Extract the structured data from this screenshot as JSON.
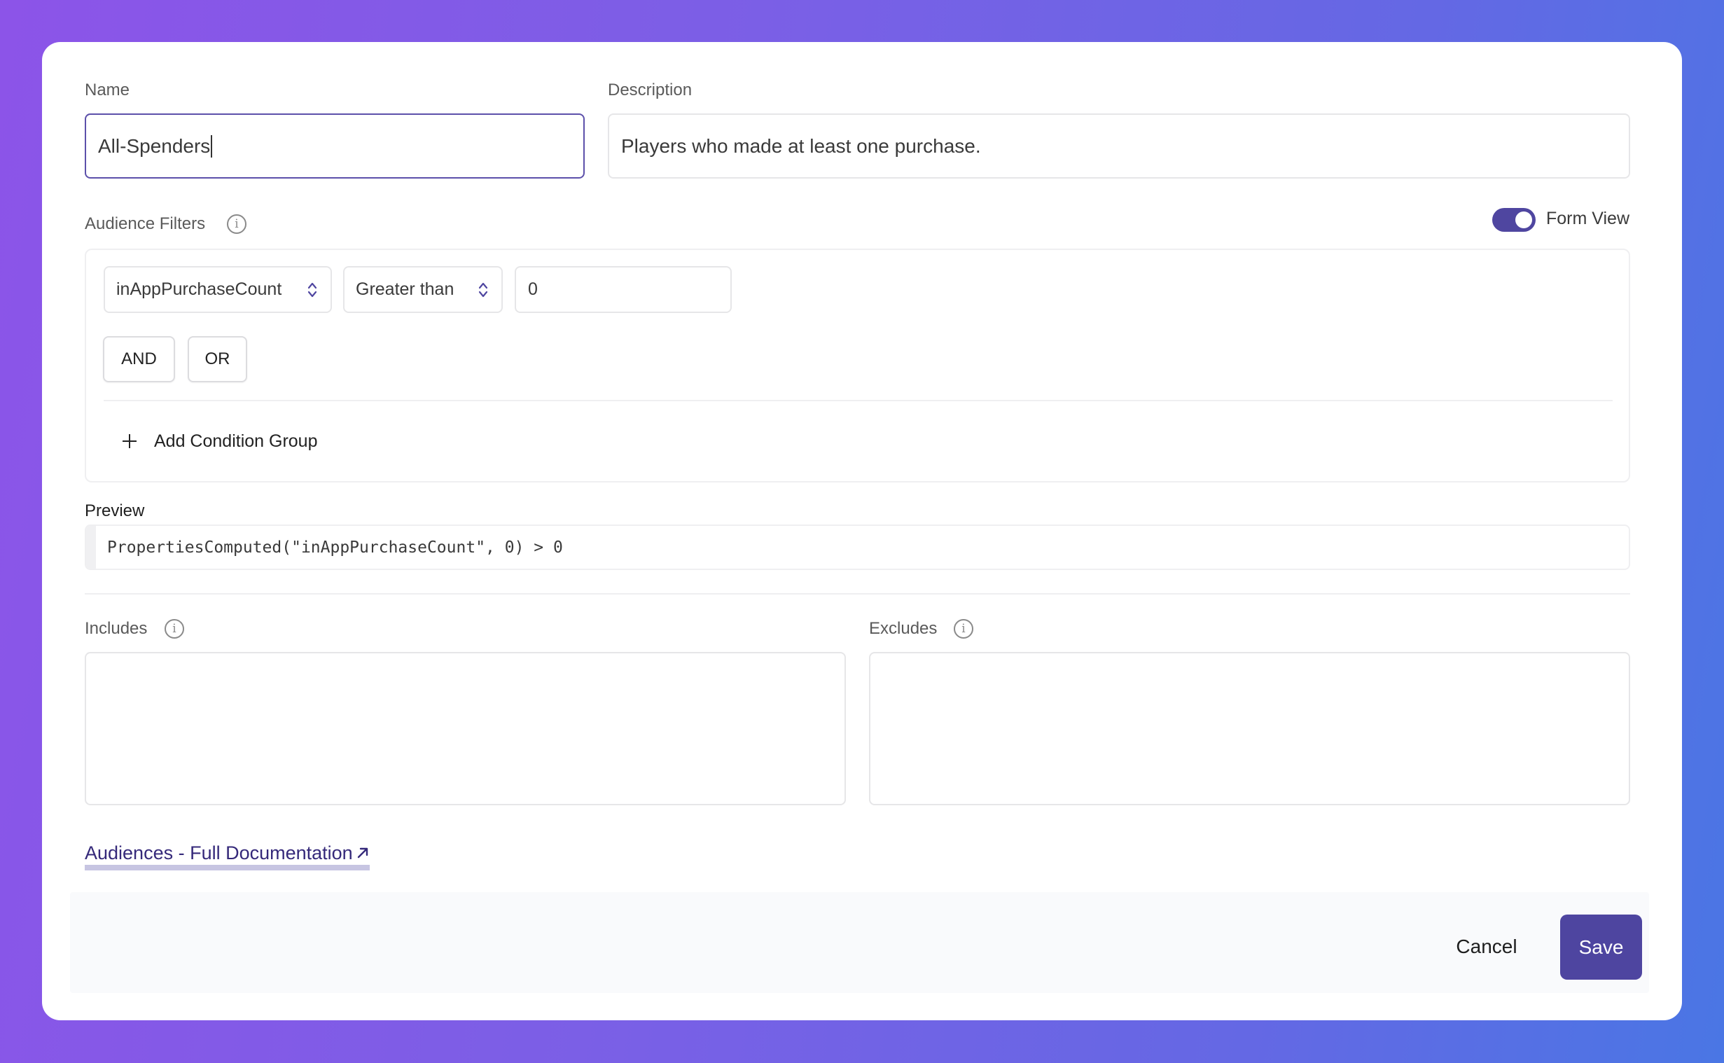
{
  "form": {
    "name": {
      "label": "Name",
      "value": "All-Spenders"
    },
    "description": {
      "label": "Description",
      "value": "Players who made at least one purchase."
    }
  },
  "audience_filters": {
    "label": "Audience Filters",
    "info_icon": "info-icon",
    "view_toggle": {
      "label": "Form View",
      "on": true
    },
    "condition": {
      "property": "inAppPurchaseCount",
      "operator": "Greater than",
      "value": "0"
    },
    "logic_buttons": [
      "AND",
      "OR"
    ],
    "add_group_label": "Add Condition Group"
  },
  "preview": {
    "label": "Preview",
    "code": "PropertiesComputed(\"inAppPurchaseCount\", 0) > 0"
  },
  "includes": {
    "label": "Includes",
    "info_icon": "info-icon"
  },
  "excludes": {
    "label": "Excludes",
    "info_icon": "info-icon"
  },
  "docs_link": {
    "label": "Audiences - Full Documentation",
    "icon": "external-link-arrow-icon"
  },
  "footer": {
    "cancel_label": "Cancel",
    "save_label": "Save"
  },
  "colors": {
    "accent": "#4e45a0",
    "link": "#35297a",
    "link_underline": "#c7c5e2",
    "background_gradient_start": "#8c54e8",
    "background_gradient_end": "#4a76e4"
  }
}
